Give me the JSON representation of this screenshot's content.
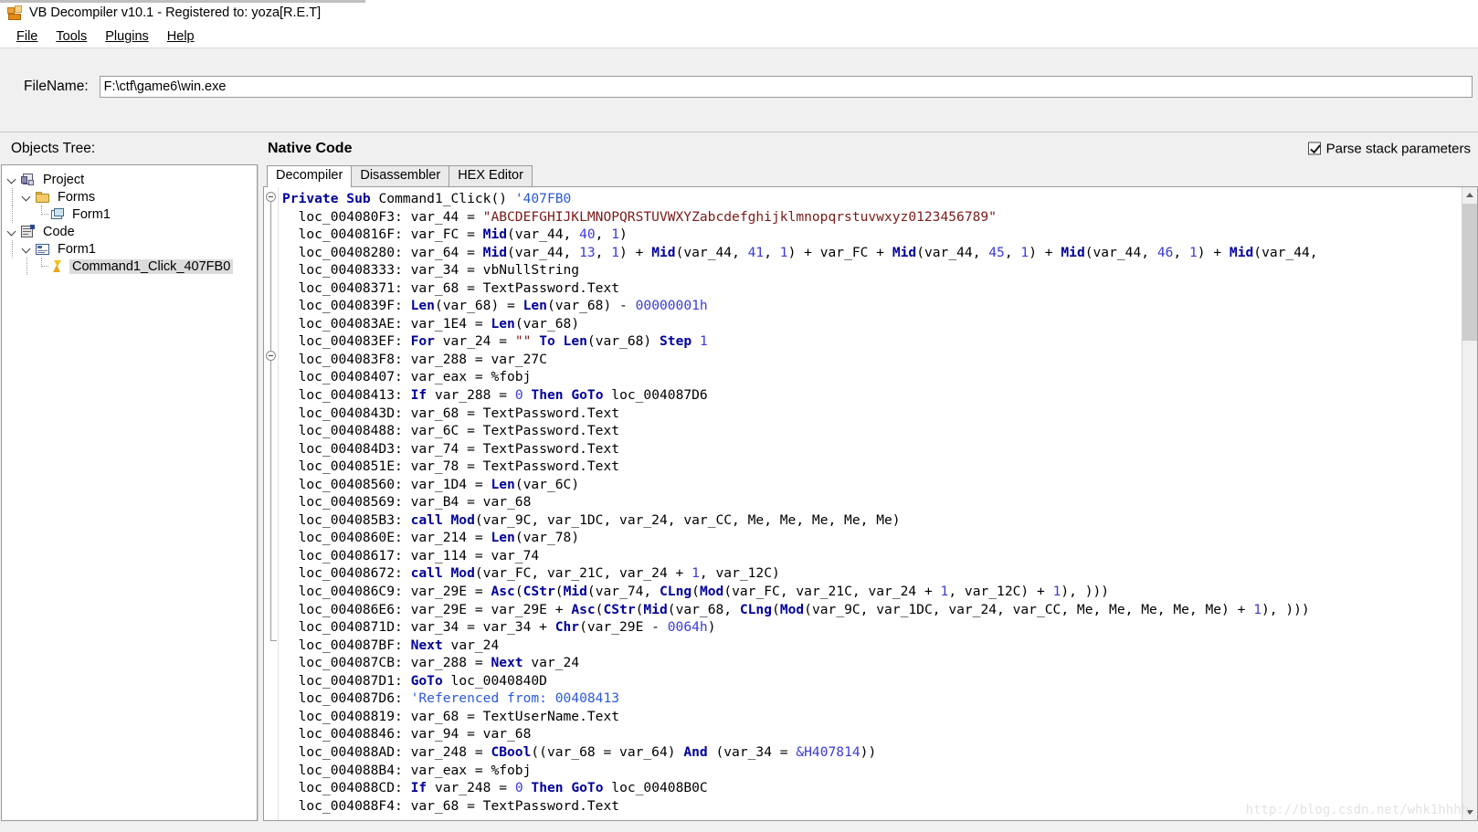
{
  "window": {
    "title": "VB Decompiler v10.1 - Registered to: yoza[R.E.T]",
    "app_icon": "vb-decompiler-icon"
  },
  "menu": {
    "items": [
      {
        "label": "File",
        "accel": "F"
      },
      {
        "label": "Tools",
        "accel": "T"
      },
      {
        "label": "Plugins",
        "accel": "P"
      },
      {
        "label": "Help",
        "accel": "H"
      }
    ]
  },
  "file_panel": {
    "label": "FileName:",
    "value": "F:\\ctf\\game6\\win.exe",
    "placeholder": ""
  },
  "headers": {
    "objects_tree": "Objects Tree:",
    "native_code": "Native Code",
    "parse_stack_parameters": "Parse stack parameters",
    "parse_stack_checked": true
  },
  "tree": {
    "nodes": [
      {
        "label": "Project",
        "icon": "project-icon",
        "depth": 0,
        "expanded": true,
        "selected": false
      },
      {
        "label": "Forms",
        "icon": "folder-icon",
        "depth": 1,
        "expanded": true,
        "selected": false
      },
      {
        "label": "Form1",
        "icon": "form-icon",
        "depth": 2,
        "expanded": null,
        "selected": false
      },
      {
        "label": "Code",
        "icon": "code-icon",
        "depth": 0,
        "expanded": true,
        "selected": false
      },
      {
        "label": "Form1",
        "icon": "module-icon",
        "depth": 1,
        "expanded": true,
        "selected": false
      },
      {
        "label": "Command1_Click_407FB0",
        "icon": "bolt-icon",
        "depth": 2,
        "expanded": null,
        "selected": true
      }
    ]
  },
  "tabs": [
    {
      "label": "Decompiler",
      "active": true
    },
    {
      "label": "Disassembler",
      "active": false
    },
    {
      "label": "HEX Editor",
      "active": false
    }
  ],
  "code": {
    "lines": [
      [
        {
          "t": "kw",
          "v": "Private Sub "
        },
        {
          "t": "loc",
          "v": "Command1_Click() "
        },
        {
          "t": "cmt",
          "v": "'407FB0"
        }
      ],
      [
        {
          "t": "loc",
          "v": "  loc_004080F3: var_44 = "
        },
        {
          "t": "str",
          "v": "\"ABCDEFGHIJKLMNOPQRSTUVWXYZabcdefghijklmnopqrstuvwxyz0123456789\""
        }
      ],
      [
        {
          "t": "loc",
          "v": "  loc_0040816F: var_FC = "
        },
        {
          "t": "kw",
          "v": "Mid"
        },
        {
          "t": "loc",
          "v": "(var_44, "
        },
        {
          "t": "num",
          "v": "40"
        },
        {
          "t": "loc",
          "v": ", "
        },
        {
          "t": "num",
          "v": "1"
        },
        {
          "t": "loc",
          "v": ")"
        }
      ],
      [
        {
          "t": "loc",
          "v": "  loc_00408280: var_64 = "
        },
        {
          "t": "kw",
          "v": "Mid"
        },
        {
          "t": "loc",
          "v": "(var_44, "
        },
        {
          "t": "num",
          "v": "13"
        },
        {
          "t": "loc",
          "v": ", "
        },
        {
          "t": "num",
          "v": "1"
        },
        {
          "t": "loc",
          "v": ") + "
        },
        {
          "t": "kw",
          "v": "Mid"
        },
        {
          "t": "loc",
          "v": "(var_44, "
        },
        {
          "t": "num",
          "v": "41"
        },
        {
          "t": "loc",
          "v": ", "
        },
        {
          "t": "num",
          "v": "1"
        },
        {
          "t": "loc",
          "v": ") + var_FC + "
        },
        {
          "t": "kw",
          "v": "Mid"
        },
        {
          "t": "loc",
          "v": "(var_44, "
        },
        {
          "t": "num",
          "v": "45"
        },
        {
          "t": "loc",
          "v": ", "
        },
        {
          "t": "num",
          "v": "1"
        },
        {
          "t": "loc",
          "v": ") + "
        },
        {
          "t": "kw",
          "v": "Mid"
        },
        {
          "t": "loc",
          "v": "(var_44, "
        },
        {
          "t": "num",
          "v": "46"
        },
        {
          "t": "loc",
          "v": ", "
        },
        {
          "t": "num",
          "v": "1"
        },
        {
          "t": "loc",
          "v": ") + "
        },
        {
          "t": "kw",
          "v": "Mid"
        },
        {
          "t": "loc",
          "v": "(var_44,"
        }
      ],
      [
        {
          "t": "loc",
          "v": "  loc_00408333: var_34 = vbNullString"
        }
      ],
      [
        {
          "t": "loc",
          "v": "  loc_00408371: var_68 = TextPassword.Text"
        }
      ],
      [
        {
          "t": "loc",
          "v": "  loc_0040839F: "
        },
        {
          "t": "kw",
          "v": "Len"
        },
        {
          "t": "loc",
          "v": "(var_68) = "
        },
        {
          "t": "kw",
          "v": "Len"
        },
        {
          "t": "loc",
          "v": "(var_68) - "
        },
        {
          "t": "num",
          "v": "00000001h"
        }
      ],
      [
        {
          "t": "loc",
          "v": "  loc_004083AE: var_1E4 = "
        },
        {
          "t": "kw",
          "v": "Len"
        },
        {
          "t": "loc",
          "v": "(var_68)"
        }
      ],
      [
        {
          "t": "loc",
          "v": "  loc_004083EF: "
        },
        {
          "t": "kw",
          "v": "For "
        },
        {
          "t": "loc",
          "v": "var_24 = "
        },
        {
          "t": "str",
          "v": "\"\""
        },
        {
          "t": "kw",
          "v": " To Len"
        },
        {
          "t": "loc",
          "v": "(var_68) "
        },
        {
          "t": "kw",
          "v": "Step "
        },
        {
          "t": "num",
          "v": "1"
        }
      ],
      [
        {
          "t": "loc",
          "v": "  loc_004083F8: var_288 = var_27C"
        }
      ],
      [
        {
          "t": "loc",
          "v": "  loc_00408407: var_eax = %fobj"
        }
      ],
      [
        {
          "t": "loc",
          "v": "  loc_00408413: "
        },
        {
          "t": "kw",
          "v": "If "
        },
        {
          "t": "loc",
          "v": "var_288 = "
        },
        {
          "t": "num",
          "v": "0"
        },
        {
          "t": "kw",
          "v": " Then GoTo "
        },
        {
          "t": "loc",
          "v": "loc_004087D6"
        }
      ],
      [
        {
          "t": "loc",
          "v": "  loc_0040843D: var_68 = TextPassword.Text"
        }
      ],
      [
        {
          "t": "loc",
          "v": "  loc_00408488: var_6C = TextPassword.Text"
        }
      ],
      [
        {
          "t": "loc",
          "v": "  loc_004084D3: var_74 = TextPassword.Text"
        }
      ],
      [
        {
          "t": "loc",
          "v": "  loc_0040851E: var_78 = TextPassword.Text"
        }
      ],
      [
        {
          "t": "loc",
          "v": "  loc_00408560: var_1D4 = "
        },
        {
          "t": "kw",
          "v": "Len"
        },
        {
          "t": "loc",
          "v": "(var_6C)"
        }
      ],
      [
        {
          "t": "loc",
          "v": "  loc_00408569: var_B4 = var_68"
        }
      ],
      [
        {
          "t": "loc",
          "v": "  loc_004085B3: "
        },
        {
          "t": "kw",
          "v": "call Mod"
        },
        {
          "t": "loc",
          "v": "(var_9C, var_1DC, var_24, var_CC, Me, Me, Me, Me, Me)"
        }
      ],
      [
        {
          "t": "loc",
          "v": "  loc_0040860E: var_214 = "
        },
        {
          "t": "kw",
          "v": "Len"
        },
        {
          "t": "loc",
          "v": "(var_78)"
        }
      ],
      [
        {
          "t": "loc",
          "v": "  loc_00408617: var_114 = var_74"
        }
      ],
      [
        {
          "t": "loc",
          "v": "  loc_00408672: "
        },
        {
          "t": "kw",
          "v": "call Mod"
        },
        {
          "t": "loc",
          "v": "(var_FC, var_21C, var_24 + "
        },
        {
          "t": "num",
          "v": "1"
        },
        {
          "t": "loc",
          "v": ", var_12C)"
        }
      ],
      [
        {
          "t": "loc",
          "v": "  loc_004086C9: var_29E = "
        },
        {
          "t": "kw",
          "v": "Asc"
        },
        {
          "t": "loc",
          "v": "("
        },
        {
          "t": "kw",
          "v": "CStr"
        },
        {
          "t": "loc",
          "v": "("
        },
        {
          "t": "kw",
          "v": "Mid"
        },
        {
          "t": "loc",
          "v": "(var_74, "
        },
        {
          "t": "kw",
          "v": "CLng"
        },
        {
          "t": "loc",
          "v": "("
        },
        {
          "t": "kw",
          "v": "Mod"
        },
        {
          "t": "loc",
          "v": "(var_FC, var_21C, var_24 + "
        },
        {
          "t": "num",
          "v": "1"
        },
        {
          "t": "loc",
          "v": ", var_12C) + "
        },
        {
          "t": "num",
          "v": "1"
        },
        {
          "t": "loc",
          "v": "), )))"
        }
      ],
      [
        {
          "t": "loc",
          "v": "  loc_004086E6: var_29E = var_29E + "
        },
        {
          "t": "kw",
          "v": "Asc"
        },
        {
          "t": "loc",
          "v": "("
        },
        {
          "t": "kw",
          "v": "CStr"
        },
        {
          "t": "loc",
          "v": "("
        },
        {
          "t": "kw",
          "v": "Mid"
        },
        {
          "t": "loc",
          "v": "(var_68, "
        },
        {
          "t": "kw",
          "v": "CLng"
        },
        {
          "t": "loc",
          "v": "("
        },
        {
          "t": "kw",
          "v": "Mod"
        },
        {
          "t": "loc",
          "v": "(var_9C, var_1DC, var_24, var_CC, Me, Me, Me, Me, Me) + "
        },
        {
          "t": "num",
          "v": "1"
        },
        {
          "t": "loc",
          "v": "), )))"
        }
      ],
      [
        {
          "t": "loc",
          "v": "  loc_0040871D: var_34 = var_34 + "
        },
        {
          "t": "kw",
          "v": "Chr"
        },
        {
          "t": "loc",
          "v": "(var_29E - "
        },
        {
          "t": "num",
          "v": "0064h"
        },
        {
          "t": "loc",
          "v": ")"
        }
      ],
      [
        {
          "t": "loc",
          "v": "  loc_004087BF: "
        },
        {
          "t": "kw",
          "v": "Next "
        },
        {
          "t": "loc",
          "v": "var_24"
        }
      ],
      [
        {
          "t": "loc",
          "v": "  loc_004087CB: var_288 = "
        },
        {
          "t": "kw",
          "v": "Next "
        },
        {
          "t": "loc",
          "v": "var_24"
        }
      ],
      [
        {
          "t": "loc",
          "v": "  loc_004087D1: "
        },
        {
          "t": "kw",
          "v": "GoTo "
        },
        {
          "t": "loc",
          "v": "loc_0040840D"
        }
      ],
      [
        {
          "t": "loc",
          "v": "  loc_004087D6: "
        },
        {
          "t": "cmt",
          "v": "'Referenced from: 00408413"
        }
      ],
      [
        {
          "t": "loc",
          "v": "  loc_00408819: var_68 = TextUserName.Text"
        }
      ],
      [
        {
          "t": "loc",
          "v": "  loc_00408846: var_94 = var_68"
        }
      ],
      [
        {
          "t": "loc",
          "v": "  loc_004088AD: var_248 = "
        },
        {
          "t": "kw",
          "v": "CBool"
        },
        {
          "t": "loc",
          "v": "((var_68 = var_64) "
        },
        {
          "t": "kw",
          "v": "And "
        },
        {
          "t": "loc",
          "v": "(var_34 = "
        },
        {
          "t": "num",
          "v": "&H407814"
        },
        {
          "t": "loc",
          "v": "))"
        }
      ],
      [
        {
          "t": "loc",
          "v": "  loc_004088B4: var_eax = %fobj"
        }
      ],
      [
        {
          "t": "loc",
          "v": "  loc_004088CD: "
        },
        {
          "t": "kw",
          "v": "If "
        },
        {
          "t": "loc",
          "v": "var_248 = "
        },
        {
          "t": "num",
          "v": "0"
        },
        {
          "t": "kw",
          "v": " Then GoTo "
        },
        {
          "t": "loc",
          "v": "loc_00408B0C"
        }
      ],
      [
        {
          "t": "loc",
          "v": "  loc_004088F4: var_68 = TextPassword.Text"
        }
      ]
    ]
  },
  "watermark": {
    "text": "http://blog.csdn.net/whk1hhhh"
  }
}
